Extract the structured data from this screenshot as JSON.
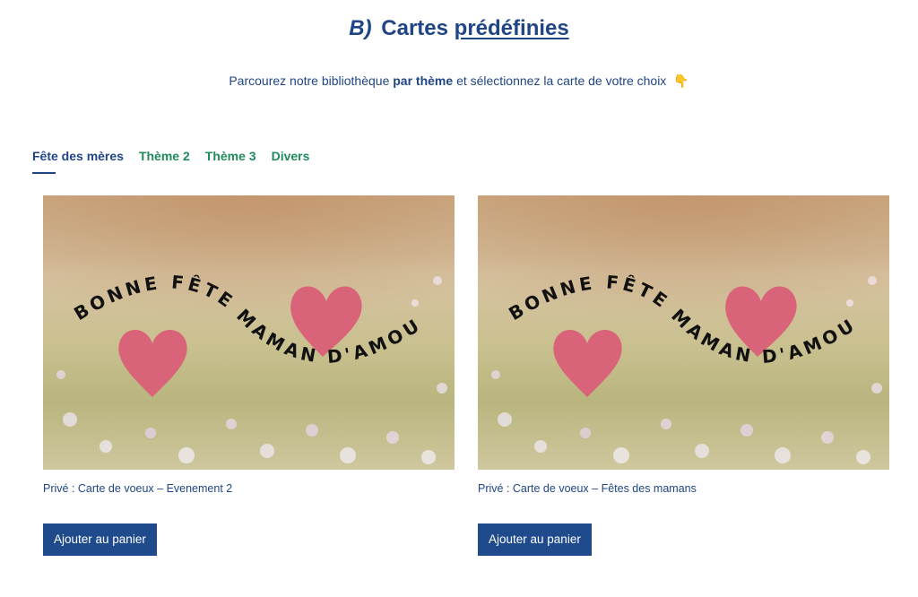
{
  "header": {
    "prefix": "B)",
    "title_plain": "Cartes",
    "title_link": "prédéfinies"
  },
  "subtitle": {
    "part1": "Parcourez notre bibliothèque",
    "bold": "par thème",
    "part2": "et sélectionnez la carte de votre choix",
    "emoji": "👇"
  },
  "tabs": [
    {
      "label": "Fête des mères",
      "active": true
    },
    {
      "label": "Thème 2",
      "active": false
    },
    {
      "label": "Thème 3",
      "active": false
    },
    {
      "label": "Divers",
      "active": false
    }
  ],
  "cards": [
    {
      "image_text": [
        "BONNE FÊTE",
        "MAMAN D'AMOUR"
      ],
      "caption": "Privé : Carte de voeux – Evenement 2",
      "button_label": "Ajouter au panier"
    },
    {
      "image_text": [
        "BONNE FÊTE",
        "MAMAN D'AMOUR"
      ],
      "caption": "Privé : Carte de voeux – Fêtes des mamans",
      "button_label": "Ajouter au panier"
    }
  ],
  "colors": {
    "primary": "#1f4585",
    "tab_green": "#1f8a5b",
    "heart": "#d96479",
    "button": "#1f4a8c"
  }
}
